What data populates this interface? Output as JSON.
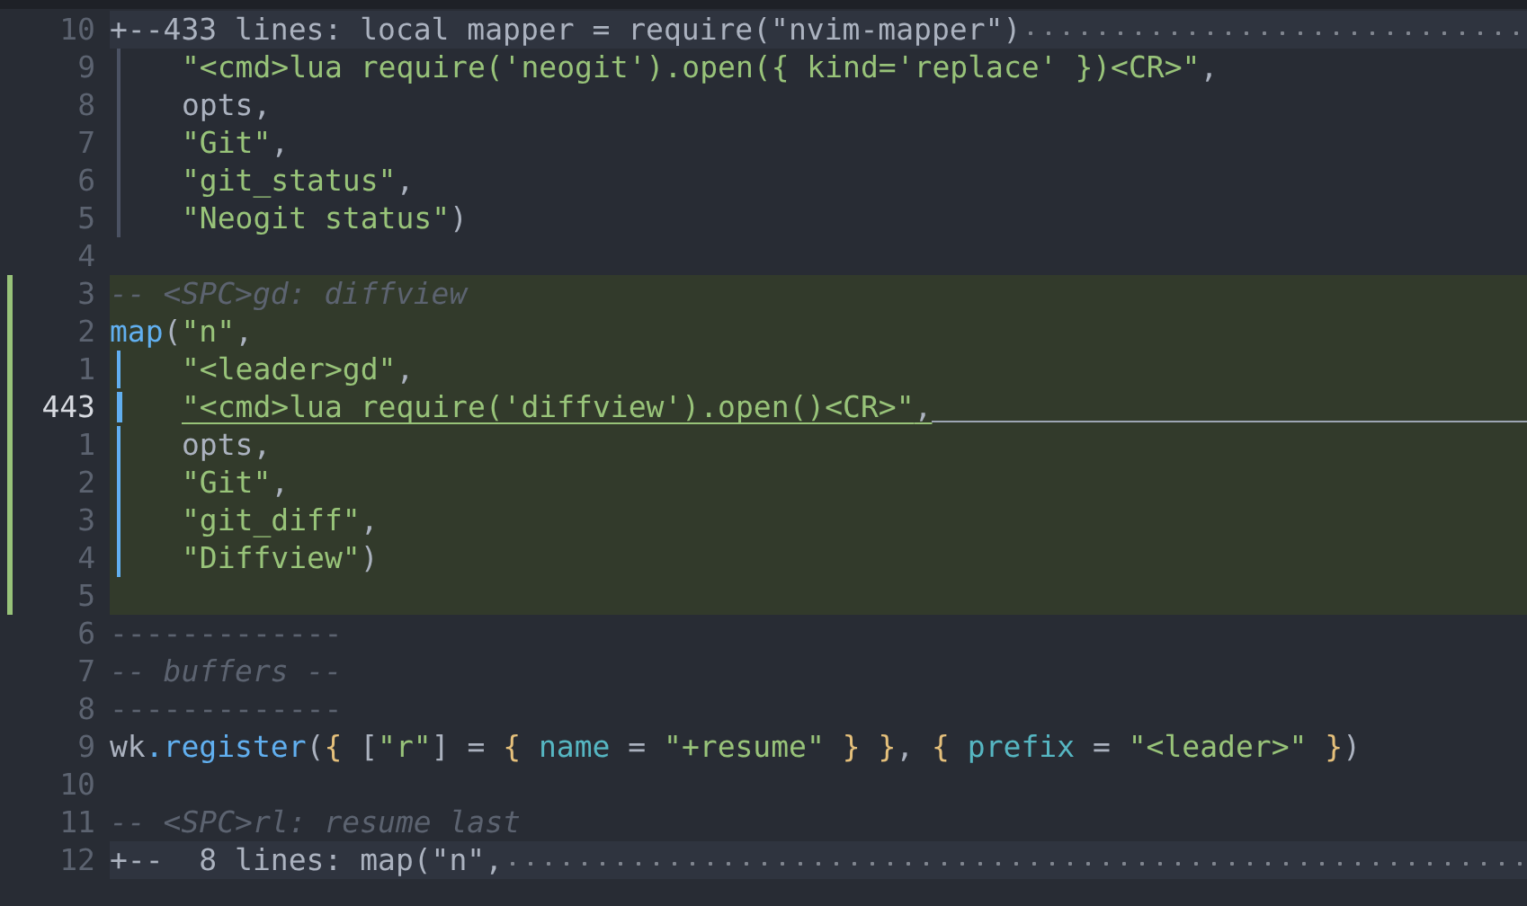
{
  "lines": [
    {
      "number": "10",
      "kind": "fold",
      "text": "+--433 lines: local mapper = require(\"nvim-mapper\")",
      "current": false
    },
    {
      "number": "9",
      "kind": "code",
      "guide": true,
      "scope_active": false,
      "highlighted": false,
      "current": false,
      "tokens": [
        {
          "text": "\"<cmd>lua require('neogit').open({ kind='replace' })<CR>\"",
          "kind": "string"
        },
        {
          "text": ",",
          "kind": "punct"
        }
      ]
    },
    {
      "number": "8",
      "kind": "code",
      "guide": true,
      "scope_active": false,
      "highlighted": false,
      "current": false,
      "tokens": [
        {
          "text": "opts,",
          "kind": "text"
        }
      ]
    },
    {
      "number": "7",
      "kind": "code",
      "guide": true,
      "scope_active": false,
      "highlighted": false,
      "current": false,
      "tokens": [
        {
          "text": "\"Git\"",
          "kind": "string"
        },
        {
          "text": ",",
          "kind": "punct"
        }
      ]
    },
    {
      "number": "6",
      "kind": "code",
      "guide": true,
      "scope_active": false,
      "highlighted": false,
      "current": false,
      "tokens": [
        {
          "text": "\"git_status\"",
          "kind": "string"
        },
        {
          "text": ",",
          "kind": "punct"
        }
      ]
    },
    {
      "number": "5",
      "kind": "code",
      "guide": true,
      "scope_active": false,
      "highlighted": false,
      "current": false,
      "tokens": [
        {
          "text": "\"Neogit status\"",
          "kind": "string"
        },
        {
          "text": ")",
          "kind": "punct"
        }
      ]
    },
    {
      "number": "4",
      "kind": "code",
      "highlighted": false,
      "current": false
    },
    {
      "number": "3",
      "kind": "code",
      "highlighted": true,
      "current": false,
      "tokens": [
        {
          "text": "-- <SPC>gd: diffview",
          "kind": "comment"
        }
      ]
    },
    {
      "number": "2",
      "kind": "code",
      "highlighted": true,
      "current": false,
      "tokens": [
        {
          "text": "map",
          "kind": "func"
        },
        {
          "text": "(",
          "kind": "punct"
        },
        {
          "text": "\"n\"",
          "kind": "string"
        },
        {
          "text": ",",
          "kind": "punct"
        }
      ]
    },
    {
      "number": "1",
      "kind": "code",
      "guide": true,
      "scope_active": true,
      "highlighted": true,
      "current": false,
      "tokens": [
        {
          "text": "\"<leader>gd\"",
          "kind": "string"
        },
        {
          "text": ",",
          "kind": "punct"
        }
      ]
    },
    {
      "number": "443",
      "kind": "code",
      "guide": true,
      "scope_active": true,
      "highlighted": true,
      "current": true,
      "tokens": [
        {
          "text": "\"<cmd>lua require('diffview').open()<CR>\"",
          "kind": "string"
        },
        {
          "text": ",",
          "kind": "punct"
        }
      ]
    },
    {
      "number": "1",
      "kind": "code",
      "guide": true,
      "scope_active": true,
      "highlighted": true,
      "current": false,
      "tokens": [
        {
          "text": "opts,",
          "kind": "text"
        }
      ]
    },
    {
      "number": "2",
      "kind": "code",
      "guide": true,
      "scope_active": true,
      "highlighted": true,
      "current": false,
      "tokens": [
        {
          "text": "\"Git\"",
          "kind": "string"
        },
        {
          "text": ",",
          "kind": "punct"
        }
      ]
    },
    {
      "number": "3",
      "kind": "code",
      "guide": true,
      "scope_active": true,
      "highlighted": true,
      "current": false,
      "tokens": [
        {
          "text": "\"git_diff\"",
          "kind": "string"
        },
        {
          "text": ",",
          "kind": "punct"
        }
      ]
    },
    {
      "number": "4",
      "kind": "code",
      "guide": true,
      "scope_active": true,
      "highlighted": true,
      "current": false,
      "tokens": [
        {
          "text": "\"Diffview\"",
          "kind": "string"
        },
        {
          "text": ")",
          "kind": "punct"
        }
      ]
    },
    {
      "number": "5",
      "kind": "code",
      "highlighted": true,
      "current": false
    },
    {
      "number": "6",
      "kind": "code",
      "highlighted": false,
      "current": false,
      "tokens": [
        {
          "text": "-------------",
          "kind": "comment_plain"
        }
      ]
    },
    {
      "number": "7",
      "kind": "code",
      "highlighted": false,
      "current": false,
      "tokens": [
        {
          "text": "-- buffers --",
          "kind": "comment"
        }
      ]
    },
    {
      "number": "8",
      "kind": "code",
      "highlighted": false,
      "current": false,
      "tokens": [
        {
          "text": "-------------",
          "kind": "comment_plain"
        }
      ]
    },
    {
      "number": "9",
      "kind": "code",
      "highlighted": false,
      "current": false,
      "tokens": [
        {
          "text": "wk",
          "kind": "text"
        },
        {
          "text": ".register",
          "kind": "func"
        },
        {
          "text": "(",
          "kind": "punct"
        },
        {
          "text": "{",
          "kind": "brace"
        },
        {
          "text": " [",
          "kind": "punct"
        },
        {
          "text": "\"r\"",
          "kind": "string"
        },
        {
          "text": "] = ",
          "kind": "punct"
        },
        {
          "text": "{",
          "kind": "brace"
        },
        {
          "text": " name",
          "kind": "field"
        },
        {
          "text": " = ",
          "kind": "punct"
        },
        {
          "text": "\"+resume\"",
          "kind": "string"
        },
        {
          "text": " }",
          "kind": "brace"
        },
        {
          "text": " }",
          "kind": "brace"
        },
        {
          "text": ", ",
          "kind": "punct"
        },
        {
          "text": "{",
          "kind": "brace"
        },
        {
          "text": " prefix",
          "kind": "field"
        },
        {
          "text": " = ",
          "kind": "punct"
        },
        {
          "text": "\"<leader>\"",
          "kind": "string"
        },
        {
          "text": " }",
          "kind": "brace"
        },
        {
          "text": ")",
          "kind": "punct"
        }
      ]
    },
    {
      "number": "10",
      "kind": "code",
      "highlighted": false,
      "current": false
    },
    {
      "number": "11",
      "kind": "code",
      "highlighted": false,
      "current": false,
      "tokens": [
        {
          "text": "-- <SPC>rl: resume last",
          "kind": "comment"
        }
      ]
    },
    {
      "number": "12",
      "kind": "fold",
      "text": "+--  8 lines: map(\"n\",",
      "current": false
    }
  ]
}
